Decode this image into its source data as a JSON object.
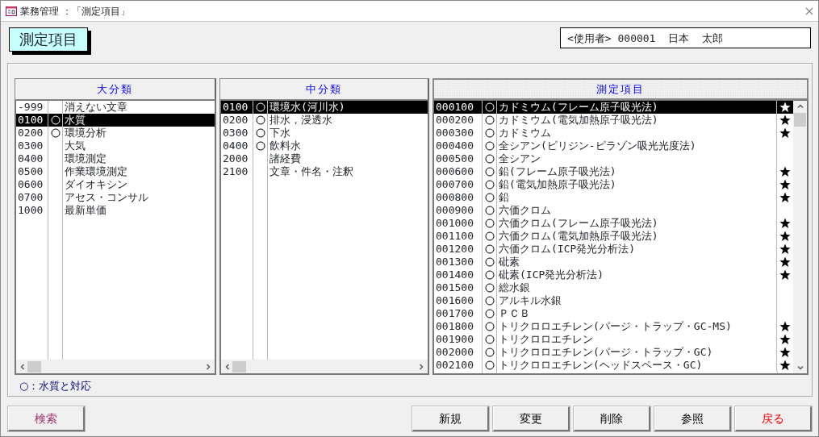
{
  "window": {
    "title": "業務管理 ：「測定項目」"
  },
  "heading": "測定項目",
  "user": "<使用者> 000001  日本  太郎",
  "lists": [
    {
      "header": "大分類",
      "kind": "plain",
      "items": [
        {
          "code": "-999",
          "water_quality": false,
          "name": "消えない文章",
          "selected": false
        },
        {
          "code": "0100",
          "water_quality": true,
          "name": "水質",
          "selected": true
        },
        {
          "code": "0200",
          "water_quality": true,
          "name": "環境分析",
          "selected": false
        },
        {
          "code": "0300",
          "water_quality": false,
          "name": "大気",
          "selected": false
        },
        {
          "code": "0400",
          "water_quality": false,
          "name": "環境測定",
          "selected": false
        },
        {
          "code": "0500",
          "water_quality": false,
          "name": "作業環境測定",
          "selected": false
        },
        {
          "code": "0600",
          "water_quality": false,
          "name": "ダイオキシン",
          "selected": false
        },
        {
          "code": "0700",
          "water_quality": false,
          "name": "アセス・コンサル",
          "selected": false
        },
        {
          "code": "1000",
          "water_quality": false,
          "name": "最新単価",
          "selected": false
        }
      ]
    },
    {
      "header": "中分類",
      "kind": "plain",
      "items": [
        {
          "code": "0100",
          "water_quality": true,
          "name": "環境水(河川水)",
          "selected": true
        },
        {
          "code": "0200",
          "water_quality": true,
          "name": "排水，浸透水",
          "selected": false
        },
        {
          "code": "0300",
          "water_quality": true,
          "name": "下水",
          "selected": false
        },
        {
          "code": "0400",
          "water_quality": true,
          "name": "飲料水",
          "selected": false
        },
        {
          "code": "2000",
          "water_quality": false,
          "name": "諸経費",
          "selected": false
        },
        {
          "code": "2100",
          "water_quality": false,
          "name": "文章・件名・注釈",
          "selected": false
        }
      ]
    },
    {
      "header": "測定項目",
      "kind": "starred",
      "items": [
        {
          "code": "000100",
          "water_quality": true,
          "name": "カドミウム(フレーム原子吸光法)",
          "starred": true,
          "selected": true
        },
        {
          "code": "000200",
          "water_quality": true,
          "name": "カドミウム(電気加熱原子吸光法)",
          "starred": true,
          "selected": false
        },
        {
          "code": "000300",
          "water_quality": true,
          "name": "カドミウム",
          "starred": true,
          "selected": false
        },
        {
          "code": "000400",
          "water_quality": true,
          "name": "全シアン(ピリジン-ピラゾン吸光光度法)",
          "starred": false,
          "selected": false
        },
        {
          "code": "000500",
          "water_quality": true,
          "name": "全シアン",
          "starred": false,
          "selected": false
        },
        {
          "code": "000600",
          "water_quality": true,
          "name": "鉛(フレーム原子吸光法)",
          "starred": true,
          "selected": false
        },
        {
          "code": "000700",
          "water_quality": true,
          "name": "鉛(電気加熱原子吸光法)",
          "starred": true,
          "selected": false
        },
        {
          "code": "000800",
          "water_quality": true,
          "name": "鉛",
          "starred": true,
          "selected": false
        },
        {
          "code": "000900",
          "water_quality": true,
          "name": "六価クロム",
          "starred": false,
          "selected": false
        },
        {
          "code": "001000",
          "water_quality": true,
          "name": "六価クロム(フレーム原子吸光法)",
          "starred": true,
          "selected": false
        },
        {
          "code": "001100",
          "water_quality": true,
          "name": "六価クロム(電気加熱原子吸光法)",
          "starred": true,
          "selected": false
        },
        {
          "code": "001200",
          "water_quality": true,
          "name": "六価クロム(ICP発光分析法)",
          "starred": true,
          "selected": false
        },
        {
          "code": "001300",
          "water_quality": true,
          "name": "砒素",
          "starred": true,
          "selected": false
        },
        {
          "code": "001400",
          "water_quality": true,
          "name": "砒素(ICP発光分析法)",
          "starred": true,
          "selected": false
        },
        {
          "code": "001500",
          "water_quality": true,
          "name": "総水銀",
          "starred": false,
          "selected": false
        },
        {
          "code": "001600",
          "water_quality": true,
          "name": "アルキル水銀",
          "starred": false,
          "selected": false
        },
        {
          "code": "001700",
          "water_quality": true,
          "name": "ＰＣＢ",
          "starred": false,
          "selected": false
        },
        {
          "code": "001800",
          "water_quality": true,
          "name": "トリクロロエチレン(パージ・トラップ・GC-MS)",
          "starred": true,
          "selected": false
        },
        {
          "code": "001900",
          "water_quality": true,
          "name": "トリクロロエチレン",
          "starred": true,
          "selected": false
        },
        {
          "code": "002000",
          "water_quality": true,
          "name": "トリクロロエチレン(パージ・トラップ・GC)",
          "starred": true,
          "selected": false
        },
        {
          "code": "002100",
          "water_quality": true,
          "name": "トリクロロエチレン(ヘッドスペース・GC)",
          "starred": true,
          "selected": false
        }
      ]
    }
  ],
  "legend": "○：水質と対応",
  "left_buttons": [
    {
      "label": "検索",
      "kind": "search"
    }
  ],
  "right_buttons": [
    {
      "label": "新規",
      "kind": "plain"
    },
    {
      "label": "変更",
      "kind": "plain"
    },
    {
      "label": "削除",
      "kind": "plain"
    },
    {
      "label": "参照",
      "kind": "plain"
    },
    {
      "label": "戻る",
      "kind": "exit"
    }
  ]
}
